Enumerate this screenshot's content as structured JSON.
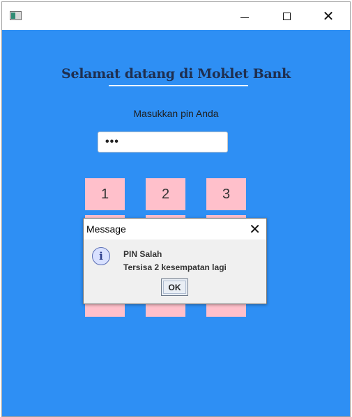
{
  "window": {
    "title": "",
    "controls": {
      "minimize": "",
      "maximize": "",
      "close": "✕"
    }
  },
  "main": {
    "heading": "Selamat datang di Moklet Bank",
    "pin_label": "Masukkan pin Anda",
    "pin_value": "•••",
    "keys": [
      "1",
      "2",
      "3",
      "",
      "",
      "",
      "",
      "",
      "",
      "",
      "",
      ""
    ]
  },
  "dialog": {
    "title": "Message",
    "close": "✕",
    "line1": "PIN Salah",
    "line2": "Tersisa 2 kesempatan lagi",
    "ok_label": "OK",
    "icon": "info-icon"
  },
  "colors": {
    "background": "#2e8ff4",
    "key": "#ffc0cb"
  }
}
